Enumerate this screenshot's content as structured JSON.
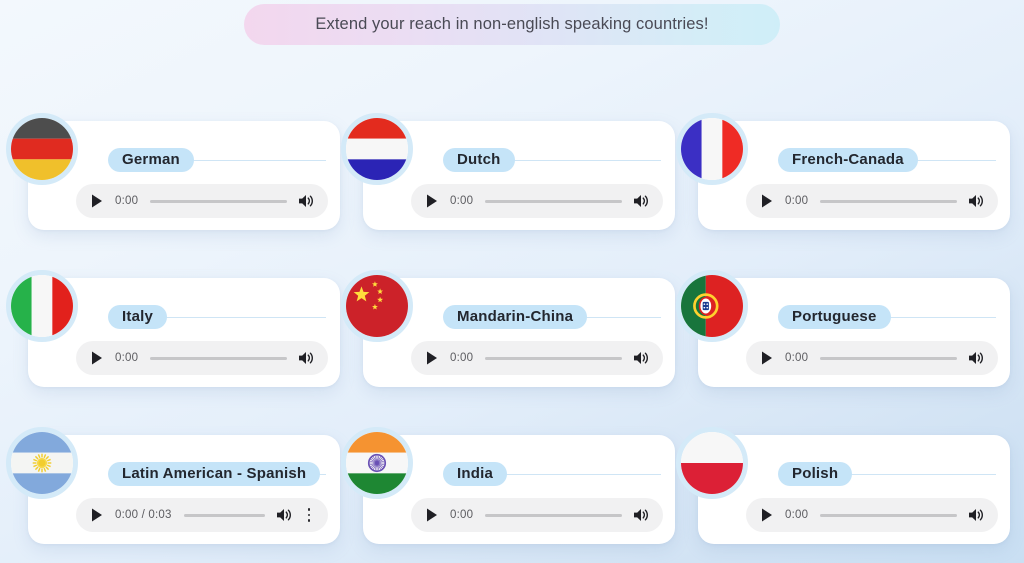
{
  "banner": {
    "text": "Extend your reach in non-english speaking countries!",
    "gradient_from": "#f3d7ee",
    "gradient_to": "#cfeef8"
  },
  "theme": {
    "background_from": "#f3f8fd",
    "background_to": "#c9dff3",
    "card_background": "#ffffff",
    "pill_background": "#c5e4f8",
    "pill_text": "#23272f",
    "avatar_ring": "#d4eaf8",
    "player_background": "#f1f1f2",
    "track_color": "#c6c6c8",
    "time_text": "#5c5c60"
  },
  "icons": {
    "play": "play-icon",
    "volume": "volume-icon",
    "menu": "kebab-menu-icon"
  },
  "cards": [
    {
      "label": "German",
      "flag": "germany-flag-icon",
      "player": {
        "time": "0:00",
        "progress": 0,
        "has_menu": false
      }
    },
    {
      "label": "Dutch",
      "flag": "netherlands-flag-icon",
      "player": {
        "time": "0:00",
        "progress": 0,
        "has_menu": false
      }
    },
    {
      "label": "French-Canada",
      "flag": "france-flag-icon",
      "player": {
        "time": "0:00",
        "progress": 0,
        "has_menu": false
      }
    },
    {
      "label": "Italy",
      "flag": "italy-flag-icon",
      "player": {
        "time": "0:00",
        "progress": 0,
        "has_menu": false
      }
    },
    {
      "label": "Mandarin-China",
      "flag": "china-flag-icon",
      "player": {
        "time": "0:00",
        "progress": 0,
        "has_menu": false
      }
    },
    {
      "label": "Portuguese",
      "flag": "portugal-flag-icon",
      "player": {
        "time": "0:00",
        "progress": 0,
        "has_menu": false
      }
    },
    {
      "label": "Latin American - Spanish",
      "flag": "argentina-flag-icon",
      "player": {
        "time": "0:00 / 0:03",
        "progress": 0,
        "has_menu": true
      }
    },
    {
      "label": "India",
      "flag": "india-flag-icon",
      "player": {
        "time": "0:00",
        "progress": 0,
        "has_menu": false
      }
    },
    {
      "label": "Polish",
      "flag": "poland-flag-icon",
      "player": {
        "time": "0:00",
        "progress": 0,
        "has_menu": false
      }
    }
  ]
}
